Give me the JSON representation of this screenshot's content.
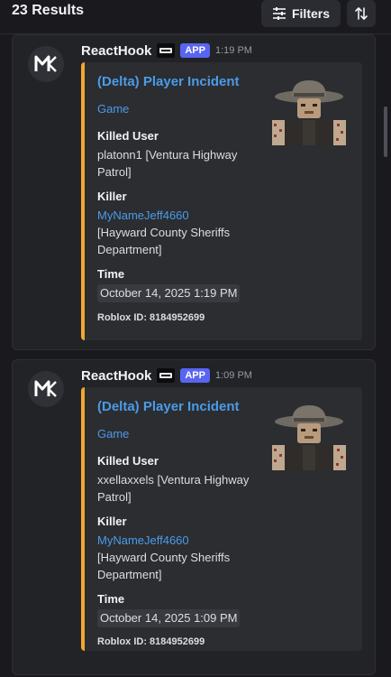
{
  "header": {
    "results_count": "23 Results",
    "filters_label": "Filters",
    "filters_icon": "sliders-icon",
    "sort_icon": "sort-arrows-icon"
  },
  "colors": {
    "embed_accent": "#f0a830",
    "link": "#4b9be8",
    "app_badge": "#5865f2"
  },
  "results": [
    {
      "author": "ReactHook",
      "badge": "APP",
      "time": "1:19 PM",
      "embed": {
        "title": "(Delta) Player Incident",
        "subtitle": "Game",
        "killed_user_label": "Killed User",
        "killed_user_value": "platonn1 [Ventura Highway Patrol]",
        "killer_label": "Killer",
        "killer_name": "MyNameJeff4660",
        "killer_team": "[Hayward County Sheriffs Department]",
        "time_label": "Time",
        "time_value": "October 14, 2025 1:19 PM",
        "footer": "Roblox ID: 8184952699"
      }
    },
    {
      "author": "ReactHook",
      "badge": "APP",
      "time": "1:09 PM",
      "embed": {
        "title": "(Delta) Player Incident",
        "subtitle": "Game",
        "killed_user_label": "Killed User",
        "killed_user_value": "xxellaxxels [Ventura Highway Patrol]",
        "killer_label": "Killer",
        "killer_name": "MyNameJeff4660",
        "killer_team": "[Hayward County Sheriffs Department]",
        "time_label": "Time",
        "time_value": "October 14, 2025 1:09 PM",
        "footer": "Roblox ID: 8184952699"
      }
    }
  ]
}
